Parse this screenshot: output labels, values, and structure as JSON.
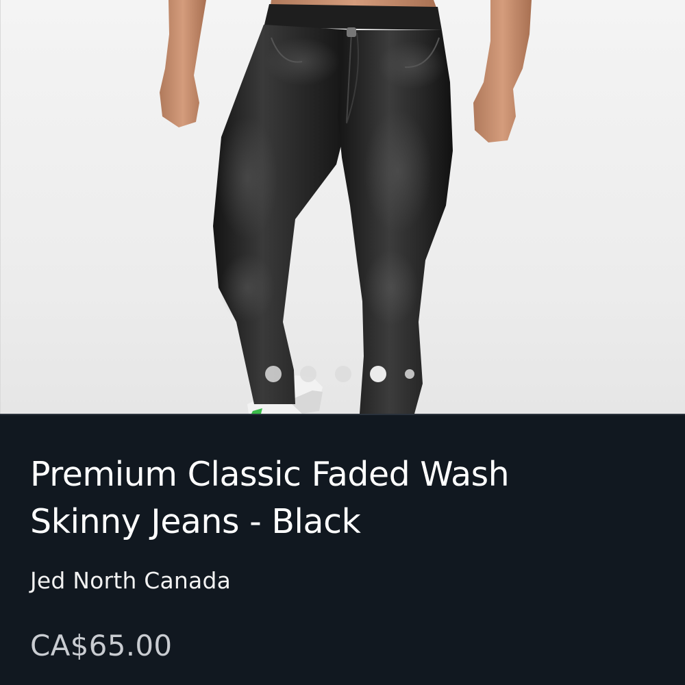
{
  "product": {
    "image_alt": "Premium Classic Faded Wash Skinny Jeans - Black",
    "carousel": {
      "slide_count": 5,
      "active_index": 3
    },
    "title_line_1": "Premium Classic Faded Wash",
    "title_line_2": "Skinny Jeans - Black",
    "brand": "Jed North Canada",
    "price": "CA$65.00"
  },
  "colors": {
    "panel_background": "#111820",
    "title_text": "#ffffff",
    "price_text": "#c9ccd1",
    "image_background": "#efefef",
    "denim": "#1c1c1c"
  }
}
